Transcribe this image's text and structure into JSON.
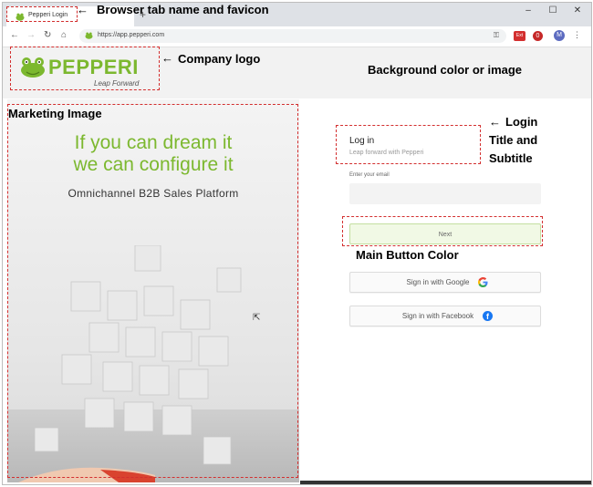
{
  "browser": {
    "tab_title": "Pepperi Login",
    "new_tab": "+",
    "url": "https://app.pepperi.com",
    "window_controls": [
      "–",
      "☐",
      "✕"
    ],
    "extensions": [
      "Ext",
      "0"
    ],
    "avatar_initial": "M",
    "nav_icons": [
      "back-icon",
      "forward-icon",
      "reload-icon",
      "home-icon"
    ]
  },
  "logo": {
    "name": "PEPPERI",
    "tagline": "Leap Forward"
  },
  "marketing": {
    "headline_1": "If you can dream it",
    "headline_2": "we can configure it",
    "subtitle": "Omnichannel B2B Sales Platform"
  },
  "login": {
    "title": "Log in",
    "subtitle": "Leap forward with Pepperi",
    "email_label": "Enter your email",
    "email_value": "",
    "next_label": "Next",
    "google_label": "Sign in with Google",
    "facebook_label": "Sign in with Facebook"
  },
  "annotations": {
    "tab": "Browser tab name and favicon",
    "logo": "Company logo",
    "background": "Background color or image",
    "marketing": "Marketing Image",
    "login_1": "Login",
    "login_2": "Title and",
    "login_3": "Subtitle",
    "button": "Main Button Color",
    "arrow": "←"
  },
  "colors": {
    "accent": "#7cb82f",
    "annotation": "#d32f2f",
    "button_bg": "#f1f9e5"
  }
}
